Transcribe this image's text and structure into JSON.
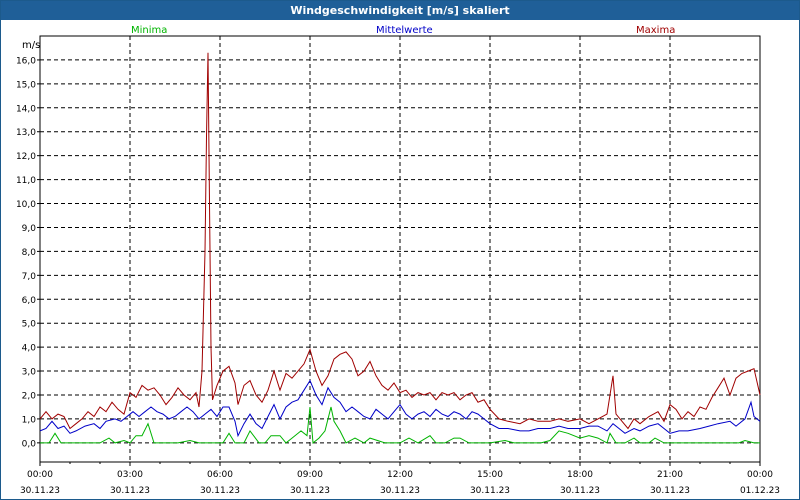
{
  "window": {
    "title": "Windgeschwindigkeit [m/s] skaliert"
  },
  "colors": {
    "minima": "#00b400",
    "mittelwerte": "#0000c8",
    "maxima": "#a00000",
    "titlebar": "#1f5f98",
    "grid": "#000000"
  },
  "chart_data": {
    "type": "line",
    "title": "Windgeschwindigkeit [m/s] skaliert",
    "ylabel": "m/s",
    "xlabel": "",
    "ylim": [
      -0.8,
      17
    ],
    "xlim_hours": [
      0,
      24
    ],
    "grid": true,
    "legend_placement": "top",
    "x_ticks": [
      {
        "time": "00:00",
        "date": "30.11.23"
      },
      {
        "time": "03:00",
        "date": "30.11.23"
      },
      {
        "time": "06:00",
        "date": "30.11.23"
      },
      {
        "time": "09:00",
        "date": "30.11.23"
      },
      {
        "time": "12:00",
        "date": "30.11.23"
      },
      {
        "time": "15:00",
        "date": "30.11.23"
      },
      {
        "time": "18:00",
        "date": "30.11.23"
      },
      {
        "time": "21:00",
        "date": "30.11.23"
      },
      {
        "time": "00:00",
        "date": "01.12.23"
      }
    ],
    "y_ticks": [
      "0,0",
      "1,0",
      "2,0",
      "3,0",
      "4,0",
      "5,0",
      "6,0",
      "7,0",
      "8,0",
      "9,0",
      "10,0",
      "11,0",
      "12,0",
      "13,0",
      "14,0",
      "15,0",
      "16,0"
    ],
    "series": [
      {
        "name": "Minima",
        "color": "#00b400",
        "points": [
          [
            0,
            0
          ],
          [
            0.3,
            0
          ],
          [
            0.5,
            0.4
          ],
          [
            0.7,
            0
          ],
          [
            1.2,
            0
          ],
          [
            1.6,
            0
          ],
          [
            2.0,
            0
          ],
          [
            2.3,
            0.2
          ],
          [
            2.5,
            0
          ],
          [
            2.8,
            0.1
          ],
          [
            3.0,
            0
          ],
          [
            3.2,
            0.3
          ],
          [
            3.4,
            0.3
          ],
          [
            3.6,
            0.8
          ],
          [
            3.8,
            0
          ],
          [
            4.2,
            0
          ],
          [
            4.6,
            0
          ],
          [
            5.0,
            0.1
          ],
          [
            5.3,
            0
          ],
          [
            5.6,
            0
          ],
          [
            5.9,
            0
          ],
          [
            6.1,
            0
          ],
          [
            6.3,
            0.4
          ],
          [
            6.5,
            0
          ],
          [
            6.8,
            0
          ],
          [
            7.0,
            0.5
          ],
          [
            7.3,
            0
          ],
          [
            7.5,
            0
          ],
          [
            7.7,
            0.3
          ],
          [
            8.0,
            0.3
          ],
          [
            8.2,
            0
          ],
          [
            8.4,
            0.2
          ],
          [
            8.7,
            0.5
          ],
          [
            8.9,
            0.3
          ],
          [
            9.0,
            1.5
          ],
          [
            9.1,
            0
          ],
          [
            9.3,
            0.2
          ],
          [
            9.5,
            0.5
          ],
          [
            9.7,
            1.5
          ],
          [
            9.8,
            0.9
          ],
          [
            10.0,
            0.5
          ],
          [
            10.2,
            0
          ],
          [
            10.5,
            0.2
          ],
          [
            10.8,
            0
          ],
          [
            11.0,
            0.2
          ],
          [
            11.5,
            0
          ],
          [
            12.0,
            0
          ],
          [
            12.3,
            0.2
          ],
          [
            12.6,
            0
          ],
          [
            13.0,
            0.3
          ],
          [
            13.2,
            0
          ],
          [
            13.5,
            0
          ],
          [
            13.8,
            0.2
          ],
          [
            14.0,
            0.2
          ],
          [
            14.3,
            0
          ],
          [
            14.6,
            0
          ],
          [
            15.0,
            0
          ],
          [
            15.5,
            0.1
          ],
          [
            15.8,
            0
          ],
          [
            16.3,
            0
          ],
          [
            16.7,
            0
          ],
          [
            17.0,
            0.1
          ],
          [
            17.3,
            0.5
          ],
          [
            17.6,
            0.4
          ],
          [
            18.0,
            0.2
          ],
          [
            18.3,
            0.3
          ],
          [
            18.6,
            0.2
          ],
          [
            18.9,
            0
          ],
          [
            19.0,
            0.4
          ],
          [
            19.2,
            0
          ],
          [
            19.5,
            0
          ],
          [
            19.8,
            0.2
          ],
          [
            20.0,
            0
          ],
          [
            20.3,
            0
          ],
          [
            20.5,
            0.2
          ],
          [
            20.8,
            0
          ],
          [
            21.0,
            0
          ],
          [
            21.5,
            0
          ],
          [
            22.0,
            0
          ],
          [
            22.5,
            0
          ],
          [
            23.0,
            0
          ],
          [
            23.3,
            0
          ],
          [
            23.5,
            0.1
          ],
          [
            23.8,
            0
          ],
          [
            24.0,
            0
          ]
        ]
      },
      {
        "name": "Mittelwerte",
        "color": "#0000c8",
        "points": [
          [
            0,
            0.5
          ],
          [
            0.2,
            0.6
          ],
          [
            0.4,
            0.9
          ],
          [
            0.6,
            0.6
          ],
          [
            0.8,
            0.7
          ],
          [
            1.0,
            0.4
          ],
          [
            1.2,
            0.5
          ],
          [
            1.5,
            0.7
          ],
          [
            1.8,
            0.8
          ],
          [
            2.0,
            0.6
          ],
          [
            2.2,
            0.9
          ],
          [
            2.5,
            1.0
          ],
          [
            2.7,
            0.9
          ],
          [
            2.9,
            1.1
          ],
          [
            3.1,
            1.3
          ],
          [
            3.3,
            1.1
          ],
          [
            3.5,
            1.3
          ],
          [
            3.7,
            1.5
          ],
          [
            3.9,
            1.3
          ],
          [
            4.1,
            1.2
          ],
          [
            4.3,
            1.0
          ],
          [
            4.5,
            1.1
          ],
          [
            4.7,
            1.3
          ],
          [
            4.9,
            1.5
          ],
          [
            5.1,
            1.3
          ],
          [
            5.3,
            1.0
          ],
          [
            5.5,
            1.2
          ],
          [
            5.7,
            1.4
          ],
          [
            5.9,
            1.1
          ],
          [
            6.1,
            1.5
          ],
          [
            6.3,
            1.5
          ],
          [
            6.5,
            0.9
          ],
          [
            6.6,
            0.3
          ],
          [
            6.8,
            0.8
          ],
          [
            7.0,
            1.2
          ],
          [
            7.2,
            0.8
          ],
          [
            7.4,
            0.6
          ],
          [
            7.6,
            1.1
          ],
          [
            7.8,
            1.6
          ],
          [
            8.0,
            1.0
          ],
          [
            8.2,
            1.5
          ],
          [
            8.4,
            1.7
          ],
          [
            8.6,
            1.8
          ],
          [
            8.8,
            2.2
          ],
          [
            9.0,
            2.6
          ],
          [
            9.2,
            2.0
          ],
          [
            9.4,
            1.6
          ],
          [
            9.6,
            2.3
          ],
          [
            9.8,
            1.9
          ],
          [
            10.0,
            1.7
          ],
          [
            10.2,
            1.3
          ],
          [
            10.4,
            1.5
          ],
          [
            10.6,
            1.3
          ],
          [
            10.8,
            1.1
          ],
          [
            11.0,
            1.0
          ],
          [
            11.2,
            1.4
          ],
          [
            11.4,
            1.2
          ],
          [
            11.6,
            1.0
          ],
          [
            11.8,
            1.3
          ],
          [
            12.0,
            1.6
          ],
          [
            12.2,
            1.2
          ],
          [
            12.4,
            1.0
          ],
          [
            12.6,
            1.2
          ],
          [
            12.8,
            1.3
          ],
          [
            13.0,
            1.1
          ],
          [
            13.2,
            1.4
          ],
          [
            13.4,
            1.2
          ],
          [
            13.6,
            1.1
          ],
          [
            13.8,
            1.3
          ],
          [
            14.0,
            1.2
          ],
          [
            14.2,
            1.0
          ],
          [
            14.4,
            1.3
          ],
          [
            14.6,
            1.2
          ],
          [
            14.8,
            1.0
          ],
          [
            15.0,
            0.8
          ],
          [
            15.3,
            0.6
          ],
          [
            15.6,
            0.6
          ],
          [
            16.0,
            0.5
          ],
          [
            16.3,
            0.5
          ],
          [
            16.6,
            0.6
          ],
          [
            17.0,
            0.6
          ],
          [
            17.3,
            0.7
          ],
          [
            17.6,
            0.6
          ],
          [
            18.0,
            0.6
          ],
          [
            18.3,
            0.7
          ],
          [
            18.6,
            0.7
          ],
          [
            18.9,
            0.5
          ],
          [
            19.1,
            0.8
          ],
          [
            19.3,
            0.6
          ],
          [
            19.5,
            0.4
          ],
          [
            19.8,
            0.6
          ],
          [
            20.0,
            0.5
          ],
          [
            20.3,
            0.7
          ],
          [
            20.6,
            0.8
          ],
          [
            20.8,
            0.6
          ],
          [
            21.0,
            0.4
          ],
          [
            21.3,
            0.5
          ],
          [
            21.6,
            0.5
          ],
          [
            22.0,
            0.6
          ],
          [
            22.3,
            0.7
          ],
          [
            22.6,
            0.8
          ],
          [
            23.0,
            0.9
          ],
          [
            23.2,
            0.7
          ],
          [
            23.5,
            1.0
          ],
          [
            23.7,
            1.7
          ],
          [
            23.8,
            1.1
          ],
          [
            24.0,
            0.9
          ]
        ]
      },
      {
        "name": "Maxima",
        "color": "#a00000",
        "points": [
          [
            0,
            1.0
          ],
          [
            0.2,
            1.3
          ],
          [
            0.4,
            1.0
          ],
          [
            0.6,
            1.2
          ],
          [
            0.8,
            1.1
          ],
          [
            1.0,
            0.6
          ],
          [
            1.2,
            0.8
          ],
          [
            1.4,
            1.0
          ],
          [
            1.6,
            1.3
          ],
          [
            1.8,
            1.1
          ],
          [
            2.0,
            1.5
          ],
          [
            2.2,
            1.3
          ],
          [
            2.4,
            1.7
          ],
          [
            2.6,
            1.4
          ],
          [
            2.8,
            1.2
          ],
          [
            3.0,
            2.1
          ],
          [
            3.2,
            1.9
          ],
          [
            3.4,
            2.4
          ],
          [
            3.6,
            2.2
          ],
          [
            3.8,
            2.3
          ],
          [
            4.0,
            2.0
          ],
          [
            4.2,
            1.6
          ],
          [
            4.4,
            1.9
          ],
          [
            4.6,
            2.3
          ],
          [
            4.8,
            2.0
          ],
          [
            5.0,
            1.8
          ],
          [
            5.2,
            2.1
          ],
          [
            5.3,
            1.5
          ],
          [
            5.4,
            3.0
          ],
          [
            5.5,
            8.0
          ],
          [
            5.55,
            12.8
          ],
          [
            5.6,
            16.3
          ],
          [
            5.65,
            10.0
          ],
          [
            5.7,
            4.0
          ],
          [
            5.75,
            1.8
          ],
          [
            5.9,
            2.4
          ],
          [
            6.1,
            3.0
          ],
          [
            6.3,
            3.2
          ],
          [
            6.5,
            2.5
          ],
          [
            6.6,
            1.6
          ],
          [
            6.8,
            2.4
          ],
          [
            7.0,
            2.6
          ],
          [
            7.2,
            2.0
          ],
          [
            7.4,
            1.7
          ],
          [
            7.6,
            2.2
          ],
          [
            7.8,
            3.0
          ],
          [
            8.0,
            2.2
          ],
          [
            8.2,
            2.9
          ],
          [
            8.4,
            2.7
          ],
          [
            8.6,
            3.0
          ],
          [
            8.8,
            3.3
          ],
          [
            9.0,
            3.9
          ],
          [
            9.2,
            3.0
          ],
          [
            9.4,
            2.4
          ],
          [
            9.6,
            2.8
          ],
          [
            9.8,
            3.5
          ],
          [
            10.0,
            3.7
          ],
          [
            10.2,
            3.8
          ],
          [
            10.4,
            3.5
          ],
          [
            10.6,
            2.8
          ],
          [
            10.8,
            3.0
          ],
          [
            11.0,
            3.4
          ],
          [
            11.2,
            2.8
          ],
          [
            11.4,
            2.4
          ],
          [
            11.6,
            2.2
          ],
          [
            11.8,
            2.5
          ],
          [
            12.0,
            2.1
          ],
          [
            12.2,
            2.2
          ],
          [
            12.4,
            1.9
          ],
          [
            12.6,
            2.1
          ],
          [
            12.8,
            2.0
          ],
          [
            13.0,
            2.1
          ],
          [
            13.2,
            1.8
          ],
          [
            13.4,
            2.1
          ],
          [
            13.6,
            2.0
          ],
          [
            13.8,
            2.1
          ],
          [
            14.0,
            1.8
          ],
          [
            14.2,
            2.0
          ],
          [
            14.4,
            2.1
          ],
          [
            14.6,
            1.7
          ],
          [
            14.8,
            1.8
          ],
          [
            15.0,
            1.4
          ],
          [
            15.3,
            1.0
          ],
          [
            15.6,
            0.9
          ],
          [
            16.0,
            0.8
          ],
          [
            16.3,
            1.0
          ],
          [
            16.6,
            0.9
          ],
          [
            17.0,
            0.9
          ],
          [
            17.3,
            1.0
          ],
          [
            17.6,
            0.9
          ],
          [
            18.0,
            1.0
          ],
          [
            18.3,
            0.8
          ],
          [
            18.6,
            1.0
          ],
          [
            18.9,
            1.2
          ],
          [
            19.1,
            2.8
          ],
          [
            19.2,
            1.2
          ],
          [
            19.4,
            0.9
          ],
          [
            19.6,
            0.6
          ],
          [
            19.8,
            1.0
          ],
          [
            20.0,
            0.8
          ],
          [
            20.3,
            1.1
          ],
          [
            20.6,
            1.3
          ],
          [
            20.8,
            0.9
          ],
          [
            21.0,
            1.6
          ],
          [
            21.2,
            1.4
          ],
          [
            21.4,
            1.0
          ],
          [
            21.6,
            1.3
          ],
          [
            21.8,
            1.1
          ],
          [
            22.0,
            1.5
          ],
          [
            22.2,
            1.4
          ],
          [
            22.4,
            1.9
          ],
          [
            22.6,
            2.3
          ],
          [
            22.8,
            2.7
          ],
          [
            23.0,
            2.0
          ],
          [
            23.2,
            2.7
          ],
          [
            23.4,
            2.9
          ],
          [
            23.6,
            3.0
          ],
          [
            23.8,
            3.1
          ],
          [
            24.0,
            2.0
          ]
        ]
      }
    ]
  }
}
